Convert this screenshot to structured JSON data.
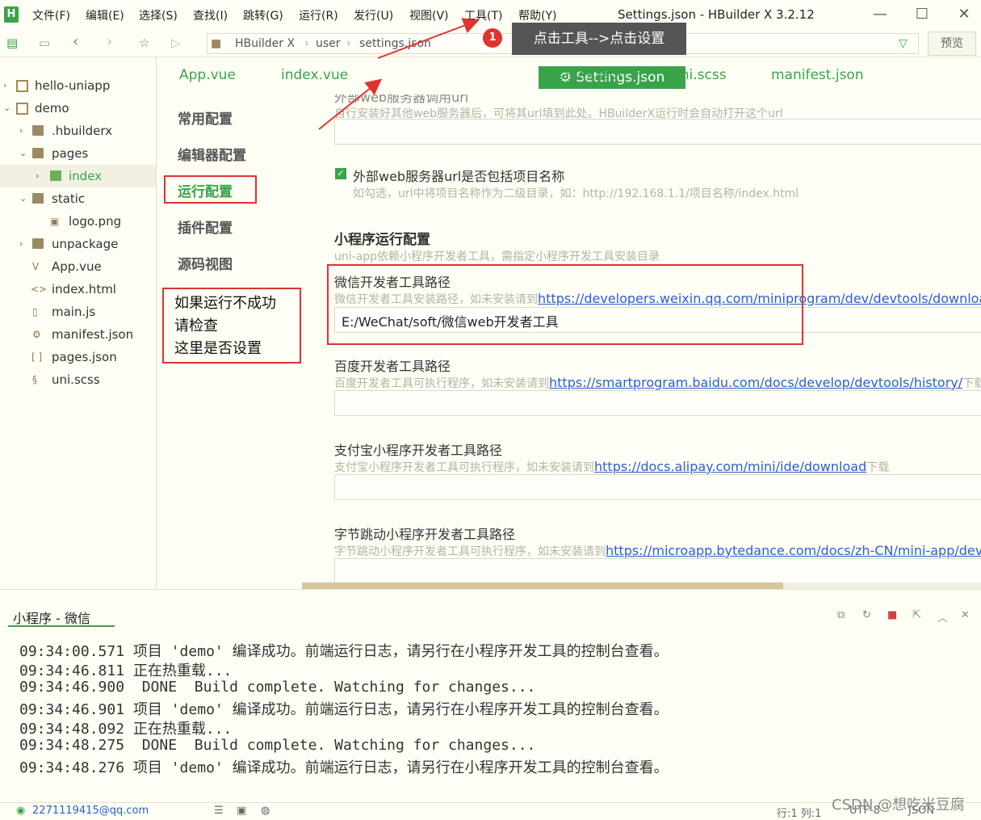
{
  "menu": {
    "items": [
      "文件(F)",
      "编辑(E)",
      "选择(S)",
      "查找(I)",
      "跳转(G)",
      "运行(R)",
      "发行(U)",
      "视图(V)",
      "工具(T)",
      "帮助(Y)"
    ],
    "window_title": "Settings.json - HBuilder X 3.2.12",
    "logo": "H"
  },
  "toolbar": {
    "breadcrumb": [
      "HBuilder X",
      "user",
      "settings.json"
    ],
    "preview_label": "预览"
  },
  "callout": {
    "badge": "1",
    "text": "点击工具-->点击设置"
  },
  "sidebar": {
    "tree": [
      {
        "label": "hello-uniapp",
        "kind": "project",
        "depth": 0,
        "arrow": "›"
      },
      {
        "label": "demo",
        "kind": "project",
        "depth": 0,
        "arrow": "⌄"
      },
      {
        "label": ".hbuilderx",
        "kind": "folder",
        "depth": 1,
        "arrow": "›"
      },
      {
        "label": "pages",
        "kind": "folder",
        "depth": 1,
        "arrow": "⌄"
      },
      {
        "label": "index",
        "kind": "folder-green",
        "depth": 2,
        "arrow": "›",
        "selected": true
      },
      {
        "label": "static",
        "kind": "folder",
        "depth": 1,
        "arrow": "⌄"
      },
      {
        "label": "logo.png",
        "kind": "image",
        "depth": 2,
        "arrow": ""
      },
      {
        "label": "unpackage",
        "kind": "folder",
        "depth": 1,
        "arrow": "›"
      },
      {
        "label": "App.vue",
        "kind": "vue",
        "depth": 1,
        "arrow": ""
      },
      {
        "label": "index.html",
        "kind": "html",
        "depth": 1,
        "arrow": ""
      },
      {
        "label": "main.js",
        "kind": "js",
        "depth": 1,
        "arrow": ""
      },
      {
        "label": "manifest.json",
        "kind": "json",
        "depth": 1,
        "arrow": ""
      },
      {
        "label": "pages.json",
        "kind": "brackets",
        "depth": 1,
        "arrow": ""
      },
      {
        "label": "uni.scss",
        "kind": "scss",
        "depth": 1,
        "arrow": ""
      }
    ]
  },
  "tabs": {
    "items": [
      "App.vue",
      "index.vue",
      "pages.json",
      "uni.scss",
      "manifest.json"
    ],
    "active": "Settings.json",
    "active_icon": "⚙"
  },
  "settings_nav": {
    "items": [
      "常用配置",
      "编辑器配置",
      "运行配置",
      "插件配置",
      "源码视图"
    ],
    "active": "运行配置",
    "note": [
      "如果运行不成功",
      "请检查",
      "这里是否设置"
    ]
  },
  "content": {
    "top_cut_label": "外部web服务器调用url",
    "top_desc": "自行安装好其他web服务器后，可将其url填到此处。HBuilderX运行时会自动打开这个url",
    "checkbox_label": "外部web服务器url是否包括项目名称",
    "checkbox_checked": true,
    "checkbox_desc": "如勾选，url中将项目名称作为二级目录，如：http://192.168.1.1/项目名称/index.html",
    "section_title": "小程序运行配置",
    "section_desc": "uni-app依赖小程序开发者工具，需指定小程序开发工具安装目录",
    "wechat": {
      "label": "微信开发者工具路径",
      "desc": "微信开发者工具安装路径，如未安装请到",
      "link": "https://developers.weixin.qq.com/miniprogram/dev/devtools/download",
      "value": "E:/WeChat/soft/微信web开发者工具"
    },
    "baidu": {
      "label": "百度开发者工具路径",
      "desc": "百度开发者工具可执行程序，如未安装请到",
      "link": "https://smartprogram.baidu.com/docs/develop/devtools/history/",
      "suffix": "下载"
    },
    "alipay": {
      "label": "支付宝小程序开发者工具路径",
      "desc": "支付宝小程序开发者工具可执行程序，如未安装请到",
      "link": "https://docs.alipay.com/mini/ide/download",
      "suffix": "下载"
    },
    "bytedance": {
      "label": "字节跳动小程序开发者工具路径",
      "desc": "字节跳动小程序开发者工具可执行程序，如未安装请到",
      "link": "https://microapp.bytedance.com/docs/zh-CN/mini-app/deve"
    }
  },
  "console": {
    "tab": "小程序 - 微信",
    "lines": [
      "09:34:00.571 项目 'demo' 编译成功。前端运行日志，请另行在小程序开发工具的控制台查看。",
      "09:34:46.811 正在热重载...",
      "09:34:46.900  DONE  Build complete. Watching for changes...",
      "09:34:46.901 项目 'demo' 编译成功。前端运行日志，请另行在小程序开发工具的控制台查看。",
      "09:34:48.092 正在热重载...",
      "09:34:48.275  DONE  Build complete. Watching for changes...",
      "09:34:48.276 项目 'demo' 编译成功。前端运行日志，请另行在小程序开发工具的控制台查看。"
    ]
  },
  "statusbar": {
    "account": "2271119415@qq.com",
    "position": "行:1   列:1",
    "encoding": "UTF-8",
    "language": "JSON"
  },
  "watermark": "CSDN @想吃米豆腐",
  "colors": {
    "accent": "#3aa34a",
    "annotation": "#e0332f",
    "background": "#fffef5",
    "link": "#2a5fd1"
  }
}
